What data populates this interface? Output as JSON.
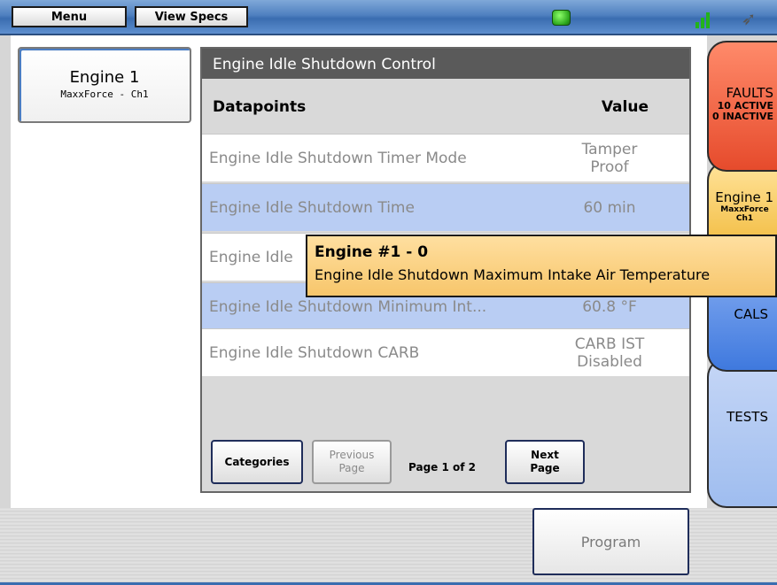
{
  "topbar": {
    "menu_label": "Menu",
    "view_specs_label": "View Specs"
  },
  "engine_card": {
    "title": "Engine 1",
    "subtitle": "MaxxForce - Ch1"
  },
  "panel": {
    "title": "Engine Idle Shutdown Control",
    "col_datapoints": "Datapoints",
    "col_value": "Value",
    "rows": [
      {
        "label": "Engine Idle Shutdown Timer Mode",
        "value_line1": "Tamper",
        "value_line2": "Proof"
      },
      {
        "label": "Engine Idle Shutdown Time",
        "value_line1": "60 min",
        "value_line2": ""
      },
      {
        "label": "Engine Idle",
        "value_line1": "",
        "value_line2": ""
      },
      {
        "label": "Engine Idle Shutdown Minimum Int...",
        "value_line1": "60.8 °F",
        "value_line2": ""
      },
      {
        "label": "Engine Idle Shutdown CARB",
        "value_line1": "CARB IST",
        "value_line2": "Disabled"
      }
    ],
    "categories_label": "Categories",
    "previous_label_1": "Previous",
    "previous_label_2": "Page",
    "page_info": "Page 1 of 2",
    "next_label_1": "Next",
    "next_label_2": "Page"
  },
  "tooltip": {
    "line1": "Engine #1 - 0",
    "line2": "Engine Idle Shutdown Maximum Intake Air Temperature"
  },
  "tabs": {
    "faults_title": "FAULTS",
    "faults_active": "10 ACTIVE",
    "faults_inactive": "0 INACTIVE",
    "engine_title": "Engine 1",
    "engine_line1": "MaxxForce",
    "engine_line2": "Ch1",
    "cals_title": "CALS",
    "tests_title": "TESTS"
  },
  "program_label": "Program",
  "colors": {
    "faults": "#e64b2c",
    "engine_tab": "#f0b530",
    "cals": "#3f79de",
    "tests": "#9fbdef",
    "highlight_row": "#b9cdf3",
    "status_led": "#2ca61c"
  },
  "icons": {
    "status": "status-led-icon",
    "signal": "signal-strength-icon",
    "connection": "plug-icon"
  }
}
